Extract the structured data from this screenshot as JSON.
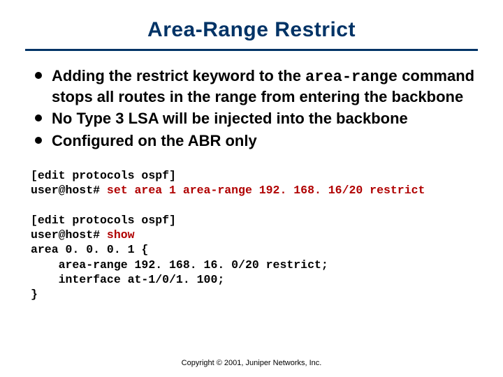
{
  "title": "Area-Range Restrict",
  "bullets": [
    {
      "pre": "Adding the restrict keyword to the ",
      "code": "area-range",
      "post": " command stops all routes in the range from entering the backbone"
    },
    {
      "pre": "No Type 3 LSA will be injected into the backbone",
      "code": "",
      "post": ""
    },
    {
      "pre": "Configured on the ABR only",
      "code": "",
      "post": ""
    }
  ],
  "terminal1": {
    "context": "[edit protocols ospf]",
    "prompt": "user@host# ",
    "input": "set area 1 area-range 192. 168. 16/20 restrict"
  },
  "terminal2": {
    "context": "[edit protocols ospf]",
    "prompt": "user@host# ",
    "input": "show",
    "output_lines": [
      "area 0. 0. 0. 1 {",
      "    area-range 192. 168. 16. 0/20 restrict;",
      "    interface at-1/0/1. 100;",
      "}"
    ]
  },
  "footer": "Copyright © 2001, Juniper Networks, Inc."
}
